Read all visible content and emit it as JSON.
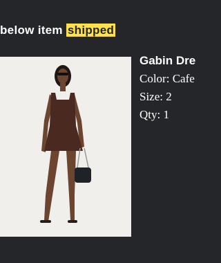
{
  "header": {
    "prefix": "below item",
    "highlight": "shipped"
  },
  "product": {
    "name": "Gabin Dre",
    "color_label": "Color: Cafe",
    "size_label": "Size: 2",
    "qty_label": "Qty: 1",
    "image_name": "product-photo",
    "colors": {
      "background": "#24262a",
      "highlight": "#ffe14d",
      "dress": "#4a2a20"
    }
  }
}
